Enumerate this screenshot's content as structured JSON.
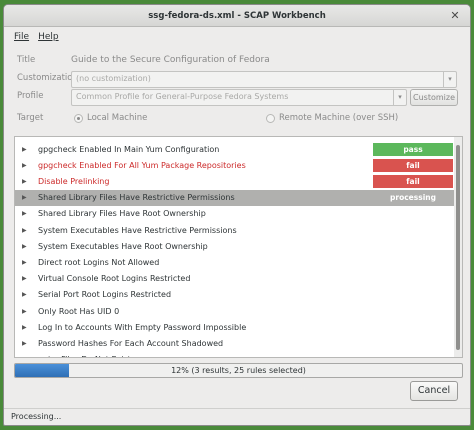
{
  "window": {
    "title": "ssg-fedora-ds.xml - SCAP Workbench",
    "close_glyph": "✕"
  },
  "menu": {
    "file": "File",
    "help": "Help"
  },
  "form": {
    "title_label": "Title",
    "title_value": "Guide to the Secure Configuration of Fedora",
    "customization_label": "Customization",
    "customization_value": "(no customization)",
    "profile_label": "Profile",
    "profile_value": "Common Profile for General-Purpose Fedora Systems",
    "customize_button": "Customize",
    "target_label": "Target",
    "local_machine": "Local Machine",
    "remote_machine": "Remote Machine (over SSH)"
  },
  "rules": [
    {
      "name": "gpgcheck Enabled In Main Yum Configuration",
      "status": "pass",
      "failed": false
    },
    {
      "name": "gpgcheck Enabled For All Yum Package Repositories",
      "status": "fail",
      "failed": true
    },
    {
      "name": "Disable Prelinking",
      "status": "fail",
      "failed": true
    },
    {
      "name": "Shared Library Files Have Restrictive Permissions",
      "status": "processing",
      "failed": false
    },
    {
      "name": "Shared Library Files Have Root Ownership",
      "status": "",
      "failed": false
    },
    {
      "name": "System Executables Have Restrictive Permissions",
      "status": "",
      "failed": false
    },
    {
      "name": "System Executables Have Root Ownership",
      "status": "",
      "failed": false
    },
    {
      "name": "Direct root Logins Not Allowed",
      "status": "",
      "failed": false
    },
    {
      "name": "Virtual Console Root Logins Restricted",
      "status": "",
      "failed": false
    },
    {
      "name": "Serial Port Root Logins Restricted",
      "status": "",
      "failed": false
    },
    {
      "name": "Only Root Has UID 0",
      "status": "",
      "failed": false
    },
    {
      "name": "Log In to Accounts With Empty Password Impossible",
      "status": "",
      "failed": false
    },
    {
      "name": "Password Hashes For Each Account Shadowed",
      "status": "",
      "failed": false
    },
    {
      "name": "netrc Files Do Not Exist",
      "status": "",
      "failed": false
    }
  ],
  "progress": {
    "text": "12% (3 results, 25 rules selected)",
    "fraction": 0.12,
    "color": "#3a80c8"
  },
  "cancel_button": "Cancel",
  "status_text": "Processing..."
}
